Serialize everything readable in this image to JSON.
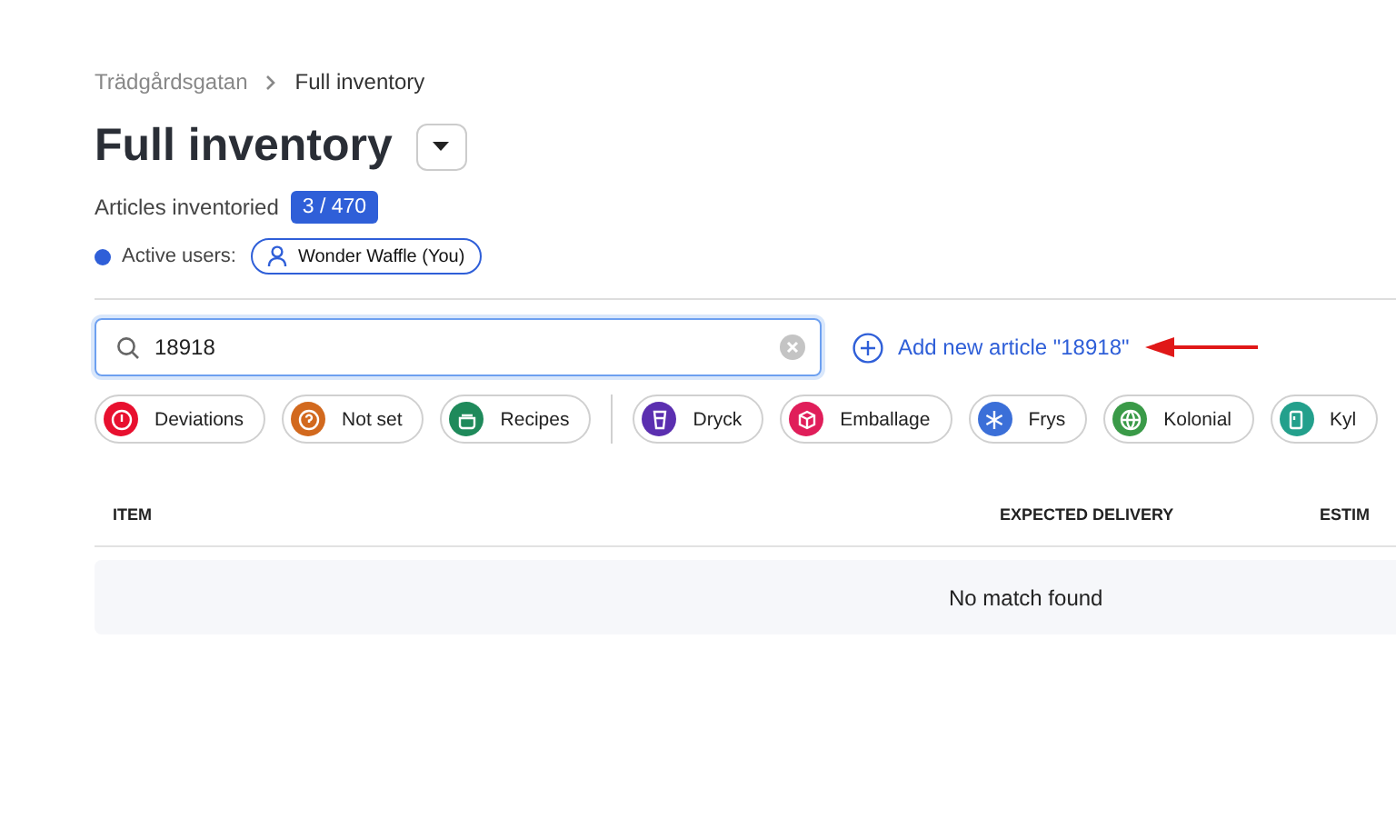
{
  "breadcrumb": [
    "Trädgårdsgatan",
    "Full inventory"
  ],
  "title": "Full inventory",
  "progress": {
    "label": "Articles inventoried",
    "count": "3 / 470"
  },
  "active_users": {
    "label": "Active users:",
    "users": [
      "Wonder Waffle (You)"
    ]
  },
  "search": {
    "value": "18918"
  },
  "add_link": "Add new article \"18918\"",
  "status_filters": [
    {
      "label": "Deviations",
      "color": "#e8102f",
      "kind": "alert"
    },
    {
      "label": "Not set",
      "color": "#d2691e",
      "kind": "question"
    },
    {
      "label": "Recipes",
      "color": "#1f8a5b",
      "kind": "pot"
    }
  ],
  "category_filters": [
    {
      "label": "Dryck",
      "color": "#5b2fb0",
      "kind": "cup"
    },
    {
      "label": "Emballage",
      "color": "#e01e5a",
      "kind": "box"
    },
    {
      "label": "Frys",
      "color": "#3b6fd8",
      "kind": "snow"
    },
    {
      "label": "Kolonial",
      "color": "#3a9a48",
      "kind": "globe"
    },
    {
      "label": "Kyl",
      "color": "#23a08c",
      "kind": "fridge"
    }
  ],
  "table": {
    "columns": [
      "ITEM",
      "EXPECTED DELIVERY",
      "ESTIM"
    ],
    "empty_message": "No match found"
  }
}
